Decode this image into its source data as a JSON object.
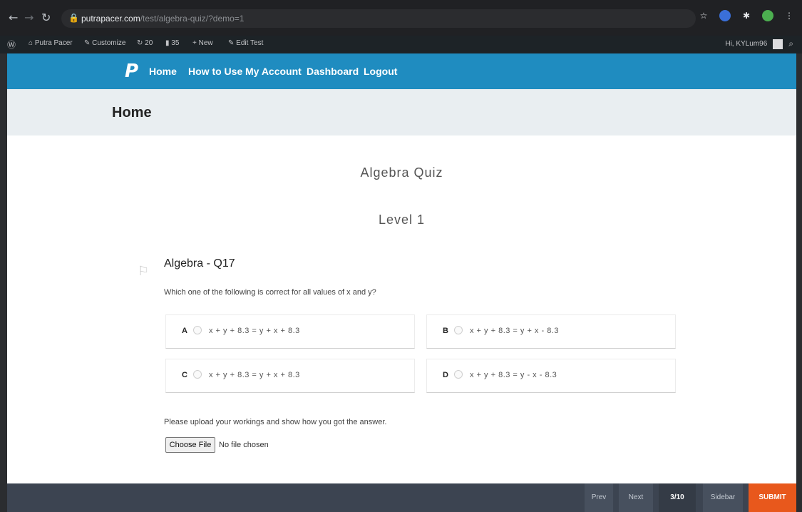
{
  "browser": {
    "url_domain": "putrapacer.com",
    "url_path": "/test/algebra-quiz/?demo=1"
  },
  "wp_admin_bar": {
    "site_name": "Putra Pacer",
    "customize": "Customize",
    "updates_count": "20",
    "comments_count": "35",
    "new_label": "New",
    "edit_label": "Edit Test",
    "howdy": "Hi, KYLum96"
  },
  "site_nav": {
    "logo": "P",
    "links": [
      "Home",
      "How to Use",
      "My Account",
      "Dashboard",
      "Logout"
    ]
  },
  "page": {
    "title": "Home"
  },
  "quiz": {
    "title": "Algebra Quiz",
    "level": "Level 1",
    "question_title": "Algebra - Q17",
    "question_text": "Which one of the following is correct for all values of x and y?",
    "options": [
      {
        "letter": "A",
        "text": "x + y + 8.3 = y + x + 8.3"
      },
      {
        "letter": "B",
        "text": "x + y + 8.3 = y + x - 8.3"
      },
      {
        "letter": "C",
        "text": "x + y + 8.3 = y + x + 8.3"
      },
      {
        "letter": "D",
        "text": "x + y + 8.3 = y - x - 8.3"
      }
    ],
    "upload_prompt": "Please upload your workings and show how you got the answer.",
    "file_button": "Choose File",
    "file_status": "No file chosen"
  },
  "bottom_bar": {
    "prev": "Prev",
    "next": "Next",
    "counter": "3/10",
    "sidebar": "Sidebar",
    "submit": "SUBMIT"
  }
}
